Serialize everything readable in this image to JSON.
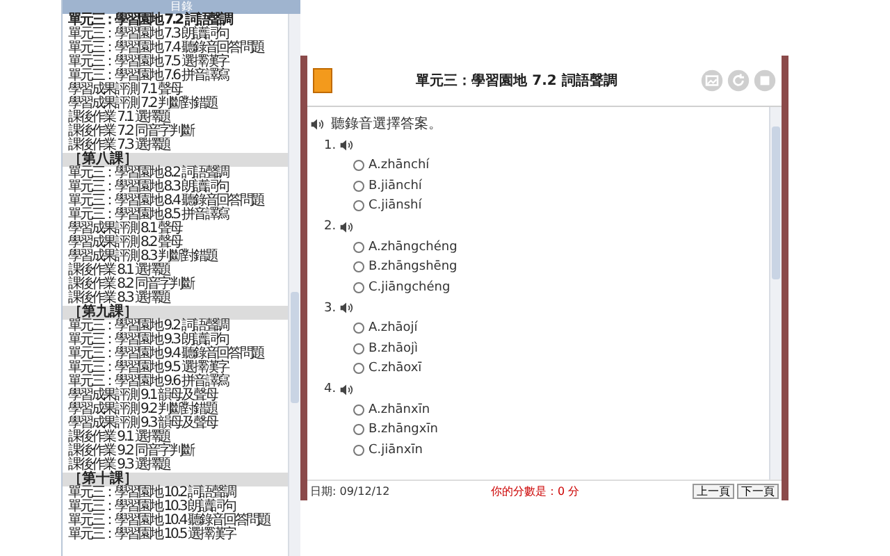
{
  "sidebar": {
    "header": "目錄",
    "items": [
      {
        "kind": "lesson",
        "text": "單元三：學習園地 7.2 詞語聲調",
        "selected": true
      },
      {
        "kind": "lesson",
        "text": "單元三：學習園地 7.3 朗讀詞句",
        "selected": false
      },
      {
        "kind": "lesson",
        "text": "單元三：學習園地 7.4 聽錄音回答問題",
        "selected": false
      },
      {
        "kind": "lesson",
        "text": "單元三：學習園地 7.5 選擇漢字",
        "selected": false
      },
      {
        "kind": "lesson",
        "text": "單元三：學習園地 7.6 拼音譯寫",
        "selected": false
      },
      {
        "kind": "lesson",
        "text": "學習成果評測 7.1 聲母",
        "selected": false
      },
      {
        "kind": "lesson",
        "text": "學習成果評測 7.2 判斷對錯題",
        "selected": false
      },
      {
        "kind": "lesson",
        "text": "課後作業 7.1 選擇題",
        "selected": false
      },
      {
        "kind": "lesson",
        "text": "課後作業 7.2 同音字判斷",
        "selected": false
      },
      {
        "kind": "lesson",
        "text": "課後作業 7.3 選擇題",
        "selected": false
      },
      {
        "kind": "heading",
        "text": "［第八課］",
        "selected": false
      },
      {
        "kind": "lesson",
        "text": "單元三：學習園地 8.2 詞語聲調",
        "selected": false
      },
      {
        "kind": "lesson",
        "text": "單元三：學習園地 8.3 朗讀詞句",
        "selected": false
      },
      {
        "kind": "lesson",
        "text": "單元三：學習園地 8.4 聽錄音回答問題",
        "selected": false
      },
      {
        "kind": "lesson",
        "text": "單元三：學習園地 8.5 拼音譯寫",
        "selected": false
      },
      {
        "kind": "lesson",
        "text": "學習成果評測 8.1 聲母",
        "selected": false
      },
      {
        "kind": "lesson",
        "text": "學習成果評測 8.2 聲母",
        "selected": false
      },
      {
        "kind": "lesson",
        "text": "學習成果評測 8.3 判斷對錯題",
        "selected": false
      },
      {
        "kind": "lesson",
        "text": "課後作業 8.1 選擇題",
        "selected": false
      },
      {
        "kind": "lesson",
        "text": "課後作業 8.2 同音字判斷",
        "selected": false
      },
      {
        "kind": "lesson",
        "text": "課後作業 8.3 選擇題",
        "selected": false
      },
      {
        "kind": "heading",
        "text": "［第九課］",
        "selected": false
      },
      {
        "kind": "lesson",
        "text": "單元三：學習園地 9.2 詞語聲調",
        "selected": false
      },
      {
        "kind": "lesson",
        "text": "單元三：學習園地 9.3 朗讀詞句",
        "selected": false
      },
      {
        "kind": "lesson",
        "text": "單元三：學習園地 9.4 聽錄音回答問題",
        "selected": false
      },
      {
        "kind": "lesson",
        "text": "單元三：學習園地 9.5 選擇漢字",
        "selected": false
      },
      {
        "kind": "lesson",
        "text": "單元三：學習園地 9.6 拼音譯寫",
        "selected": false
      },
      {
        "kind": "lesson",
        "text": "學習成果評測 9.1 韻母及聲母",
        "selected": false
      },
      {
        "kind": "lesson",
        "text": "學習成果評測 9.2 判斷對錯題",
        "selected": false
      },
      {
        "kind": "lesson",
        "text": "學習成果評測 9.3 韻母及聲母",
        "selected": false
      },
      {
        "kind": "lesson",
        "text": "課後作業 9.1 選擇題",
        "selected": false
      },
      {
        "kind": "lesson",
        "text": "課後作業 9.2 同音字判斷",
        "selected": false
      },
      {
        "kind": "lesson",
        "text": "課後作業 9.3 選擇題",
        "selected": false
      },
      {
        "kind": "heading",
        "text": "［第十課］",
        "selected": false
      },
      {
        "kind": "lesson",
        "text": "單元三：學習園地 10.2 詞語聲調",
        "selected": false
      },
      {
        "kind": "lesson",
        "text": "單元三：學習園地 10.3 朗讀詞句",
        "selected": false
      },
      {
        "kind": "lesson",
        "text": "單元三：學習園地 10.4 聽錄音回答問題",
        "selected": false
      },
      {
        "kind": "lesson",
        "text": "單元三：學習園地 10.5 選擇漢字",
        "selected": false
      }
    ]
  },
  "lesson": {
    "title": "單元三：學習園地 7.2 詞語聲調",
    "instruction": "聽錄音選擇答案。",
    "questions": [
      {
        "number": "1.",
        "options": [
          {
            "text": "A.zhānchí",
            "selected": false
          },
          {
            "text": "B.jiānchí",
            "selected": false
          },
          {
            "text": "C.jiānshí",
            "selected": false
          }
        ]
      },
      {
        "number": "2.",
        "options": [
          {
            "text": "A.zhāngchéng",
            "selected": false
          },
          {
            "text": "B.zhāngshēng",
            "selected": false
          },
          {
            "text": "C.jiāngchéng",
            "selected": false
          }
        ]
      },
      {
        "number": "3.",
        "options": [
          {
            "text": "A.zhāojí",
            "selected": false
          },
          {
            "text": "B.zhāojì",
            "selected": false
          },
          {
            "text": "C.zhāoxī",
            "selected": false
          }
        ]
      },
      {
        "number": "4.",
        "options": [
          {
            "text": "A.zhānxīn",
            "selected": false
          },
          {
            "text": "B.zhāngxīn",
            "selected": false
          },
          {
            "text": "C.jiānxīn",
            "selected": false
          }
        ]
      }
    ]
  },
  "status_bar": {
    "date": "日期: 09/12/12",
    "message": "你的分數是：0 分",
    "buttons": [
      "上一頁",
      "下一頁"
    ]
  }
}
